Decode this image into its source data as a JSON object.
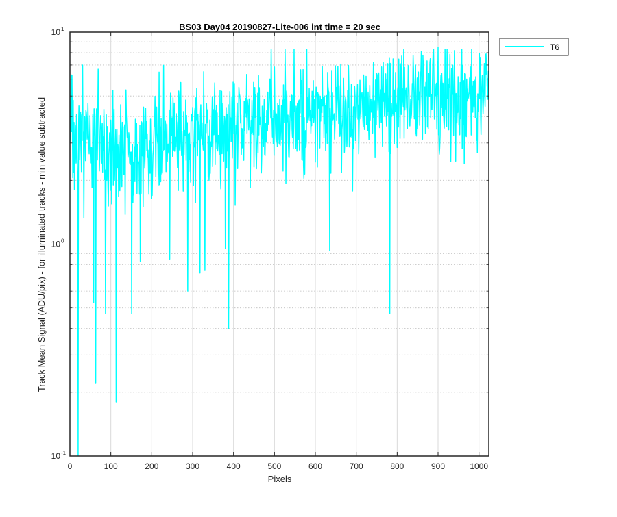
{
  "chart_data": {
    "type": "line",
    "title": "BS03 Day04 20190827-Lite-006 int time = 20 sec",
    "xlabel": "Pixels",
    "ylabel": "Track Mean Signal (ADU/pix) - for illuminated tracks - min value subtracted",
    "xlim": [
      0,
      1024
    ],
    "ylim": [
      0.1,
      10
    ],
    "yscale": "log",
    "grid": true,
    "minor_grid": true,
    "legend_position": "outside-top-right",
    "x_ticks": [
      0,
      100,
      200,
      300,
      400,
      500,
      600,
      700,
      800,
      900,
      1000
    ],
    "y_ticks": [
      {
        "value": 0.1,
        "mantissa": "10",
        "exponent": "-1"
      },
      {
        "value": 1,
        "mantissa": "10",
        "exponent": "0"
      },
      {
        "value": 10,
        "mantissa": "10",
        "exponent": "1"
      }
    ],
    "trend": {
      "x": [
        0,
        100,
        200,
        300,
        400,
        500,
        600,
        700,
        800,
        900,
        1024
      ],
      "y": [
        3.3,
        3.0,
        3.0,
        3.3,
        3.8,
        4.0,
        4.3,
        4.6,
        4.8,
        5.0,
        5.1
      ]
    },
    "dips": [
      {
        "x": 20,
        "y": 0.1
      },
      {
        "x": 63,
        "y": 0.22
      },
      {
        "x": 113,
        "y": 0.18
      },
      {
        "x": 87,
        "y": 0.47
      },
      {
        "x": 151,
        "y": 0.47
      },
      {
        "x": 58,
        "y": 0.53
      },
      {
        "x": 288,
        "y": 0.6
      },
      {
        "x": 388,
        "y": 0.4
      },
      {
        "x": 782,
        "y": 0.47
      },
      {
        "x": 318,
        "y": 0.73
      },
      {
        "x": 330,
        "y": 0.75
      },
      {
        "x": 244,
        "y": 0.85
      },
      {
        "x": 172,
        "y": 0.83
      },
      {
        "x": 635,
        "y": 0.93
      },
      {
        "x": 380,
        "y": 0.95
      }
    ],
    "peaks": [
      {
        "x": 3,
        "y": 6.3
      },
      {
        "x": 31,
        "y": 7.0
      },
      {
        "x": 900,
        "y": 8.5
      },
      {
        "x": 957,
        "y": 7.9
      },
      {
        "x": 1003,
        "y": 7.6
      }
    ],
    "series": [
      {
        "name": "T6",
        "color": "#00ffff",
        "seed": 7,
        "n": 1024
      }
    ]
  }
}
